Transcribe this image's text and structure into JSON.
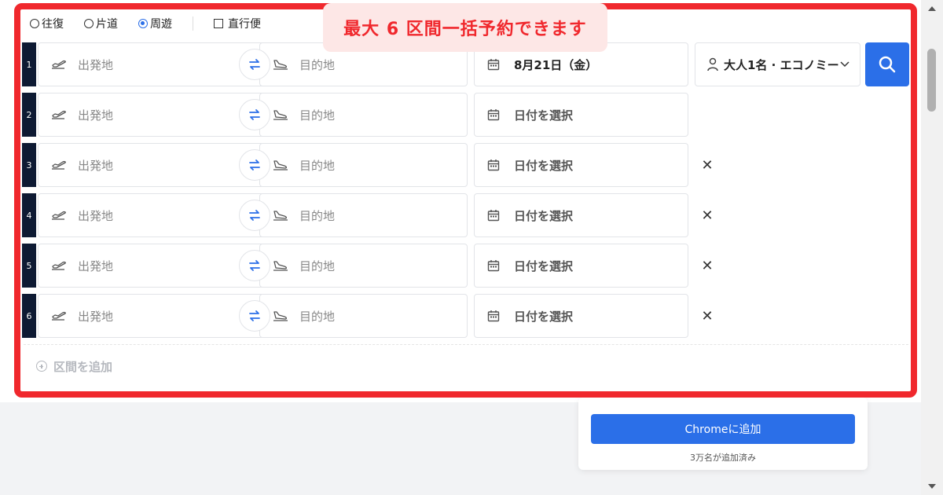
{
  "trip_types": [
    {
      "label": "往復",
      "selected": false
    },
    {
      "label": "片道",
      "selected": false
    },
    {
      "label": "周遊",
      "selected": true
    }
  ],
  "nonstop_label": "直行便",
  "callout": "最大 6 区間一括予約できます",
  "placeholders": {
    "from": "出発地",
    "to": "目的地"
  },
  "segments": [
    {
      "num": "1",
      "date": "8月21日（金）",
      "removable": false
    },
    {
      "num": "2",
      "date": "日付を選択",
      "removable": false
    },
    {
      "num": "3",
      "date": "日付を選択",
      "removable": true
    },
    {
      "num": "4",
      "date": "日付を選択",
      "removable": true
    },
    {
      "num": "5",
      "date": "日付を選択",
      "removable": true
    },
    {
      "num": "6",
      "date": "日付を選択",
      "removable": true
    }
  ],
  "passengers": "大人1名 · エコノミー",
  "add_segment": "区間を追加",
  "chrome": {
    "button": "Chromeに追加",
    "sub": "3万名が追加済み"
  },
  "colors": {
    "accent": "#2b6fe8",
    "frame": "#f0282d",
    "callout_bg": "#fde7e6",
    "row_num_bg": "#0e1a33"
  },
  "icons": {
    "takeoff": "plane-takeoff-icon",
    "landing": "plane-landing-icon",
    "swap": "swap-icon",
    "calendar": "calendar-icon",
    "person": "person-icon",
    "chevron": "chevron-down-icon",
    "search": "search-icon",
    "remove": "close-icon",
    "add": "plus-circle-icon"
  }
}
